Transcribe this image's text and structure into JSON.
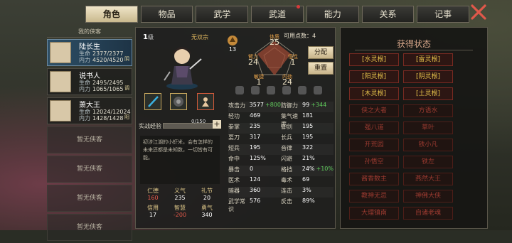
{
  "tabs": [
    {
      "label": "角色",
      "active": true
    },
    {
      "label": "物品",
      "active": false
    },
    {
      "label": "武学",
      "active": false
    },
    {
      "label": "武道",
      "active": false,
      "dot": true
    },
    {
      "label": "能力",
      "active": false
    },
    {
      "label": "关系",
      "active": false
    },
    {
      "label": "记事",
      "active": false
    }
  ],
  "hero_list": {
    "title": "我的侠客",
    "heroes": [
      {
        "name": "陆长生",
        "hp_label": "生命",
        "hp": "2377/2377",
        "mp_label": "内力",
        "mp": "4520/4520",
        "tag": "阴",
        "selected": true
      },
      {
        "name": "说书人",
        "hp_label": "生命",
        "hp": "2495/2495",
        "mp_label": "内力",
        "mp": "1065/1065",
        "tag": "调",
        "selected": false
      },
      {
        "name": "萧大王",
        "hp_label": "生命",
        "hp": "12024/12024",
        "mp_label": "内力",
        "mp": "1428/1428",
        "tag": "阳",
        "selected": false
      }
    ],
    "empty_label": "暂无侠客"
  },
  "character": {
    "level": "1",
    "level_unit": "级",
    "sect": "无双宗",
    "emblem_level": "13",
    "points_label": "可用点数：",
    "points": "4",
    "allocate_label": "分配",
    "reset_label": "重置",
    "stats": [
      {
        "key": "体质",
        "value": "25"
      },
      {
        "key": "臂力",
        "value": "24"
      },
      {
        "key": "悟性",
        "value": "1"
      },
      {
        "key": "敏捷",
        "value": "1"
      },
      {
        "key": "内劲",
        "value": "24"
      }
    ],
    "exp_label": "实战经验",
    "exp": "0/150",
    "exp_fraction": 0,
    "bio": "初涉江湖的小虾米，会有怎样的未来还都是未知数，一切皆有可能。",
    "virtues": [
      {
        "key": "仁德",
        "value": "160",
        "red": true
      },
      {
        "key": "义气",
        "value": "235",
        "red": false
      },
      {
        "key": "礼节",
        "value": "20",
        "red": false
      },
      {
        "key": "信用",
        "value": "17",
        "red": false
      },
      {
        "key": "智慧",
        "value": "-200",
        "red": true
      },
      {
        "key": "勇气",
        "value": "340",
        "red": false
      }
    ],
    "attributes": [
      [
        {
          "k": "攻击力",
          "v": "3577",
          "g": "+800"
        },
        {
          "k": "防御力",
          "v": "99",
          "g": "+344"
        }
      ],
      [
        {
          "k": "轻功",
          "v": "469",
          "g": ""
        },
        {
          "k": "集气速度",
          "v": "181",
          "g": ""
        }
      ],
      [
        {
          "k": "拳掌",
          "v": "235",
          "g": ""
        },
        {
          "k": "御剑",
          "v": "195",
          "g": ""
        }
      ],
      [
        {
          "k": "耍刀",
          "v": "317",
          "g": ""
        },
        {
          "k": "长兵",
          "v": "195",
          "g": ""
        }
      ],
      [
        {
          "k": "短兵",
          "v": "195",
          "g": ""
        },
        {
          "k": "音律",
          "v": "322",
          "g": ""
        }
      ],
      [
        {
          "k": "命中",
          "v": "125%",
          "g": ""
        },
        {
          "k": "闪避",
          "v": "21%",
          "g": ""
        }
      ],
      [
        {
          "k": "暴击",
          "v": "0",
          "g": ""
        },
        {
          "k": "格挡",
          "v": "24%",
          "g": "+10%"
        }
      ],
      [
        {
          "k": "医术",
          "v": "124",
          "g": ""
        },
        {
          "k": "毒术",
          "v": "69",
          "g": ""
        }
      ],
      [
        {
          "k": "暗器",
          "v": "360",
          "g": ""
        },
        {
          "k": "连击",
          "v": "3%",
          "g": ""
        }
      ],
      [
        {
          "k": "武学常识",
          "v": "576",
          "g": ""
        },
        {
          "k": "反击",
          "v": "89%",
          "g": ""
        }
      ]
    ]
  },
  "status": {
    "title": "获得状态",
    "items": [
      {
        "label": "[水灵根]",
        "dim": false
      },
      {
        "label": "[雷灵根]",
        "dim": false
      },
      {
        "label": "[阳灵根]",
        "dim": false
      },
      {
        "label": "[阴灵根]",
        "dim": false
      },
      {
        "label": "[木灵根]",
        "dim": false
      },
      {
        "label": "[土灵根]",
        "dim": false
      },
      {
        "label": "侠之大者",
        "dim": true
      },
      {
        "label": "方语水",
        "dim": true
      },
      {
        "label": "强八道",
        "dim": true
      },
      {
        "label": "草叶",
        "dim": true
      },
      {
        "label": "开荒园",
        "dim": true
      },
      {
        "label": "铁小凡",
        "dim": true
      },
      {
        "label": "孙悟空",
        "dim": true
      },
      {
        "label": "铁左",
        "dim": true
      },
      {
        "label": "酱香数主",
        "dim": true
      },
      {
        "label": "燕然大王",
        "dim": true
      },
      {
        "label": "教神无忌",
        "dim": true
      },
      {
        "label": "神佛大侠",
        "dim": true
      },
      {
        "label": "大理镇南",
        "dim": true
      },
      {
        "label": "自诸老魂",
        "dim": true
      }
    ]
  },
  "colors": {
    "accent": "#e4c04a",
    "gain": "#5ec95a",
    "penalty": "#e0584a",
    "selected": "#2d4f66"
  }
}
